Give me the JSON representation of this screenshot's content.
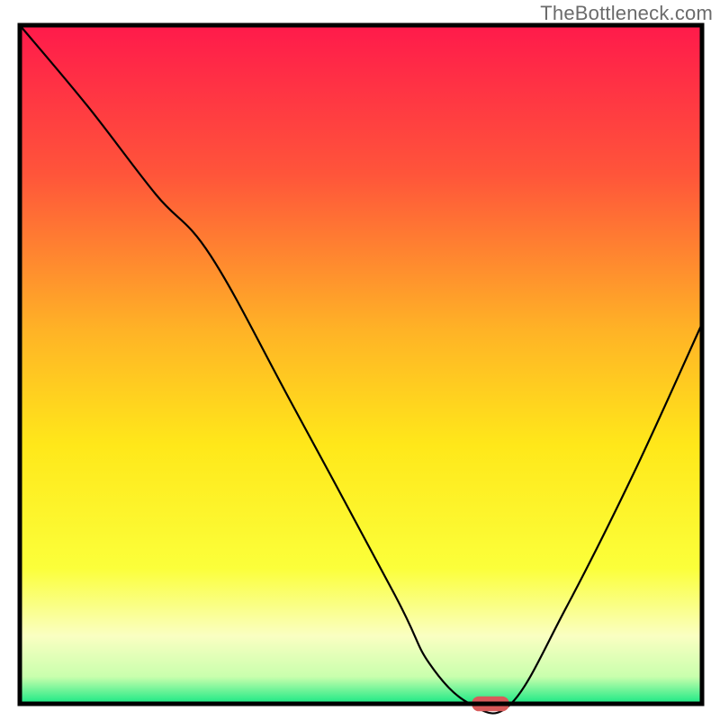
{
  "watermark": "TheBottleneck.com",
  "chart_data": {
    "type": "line",
    "title": "",
    "xlabel": "",
    "ylabel": "",
    "xlim": [
      0,
      100
    ],
    "ylim": [
      0,
      100
    ],
    "grid": false,
    "legend": false,
    "background_gradient": {
      "stops": [
        {
          "offset": 0.0,
          "color": "#ff1a4b"
        },
        {
          "offset": 0.22,
          "color": "#ff553a"
        },
        {
          "offset": 0.45,
          "color": "#ffb326"
        },
        {
          "offset": 0.62,
          "color": "#ffe81a"
        },
        {
          "offset": 0.8,
          "color": "#fbff3a"
        },
        {
          "offset": 0.9,
          "color": "#faffc2"
        },
        {
          "offset": 0.96,
          "color": "#c9ffad"
        },
        {
          "offset": 1.0,
          "color": "#17e884"
        }
      ]
    },
    "series": [
      {
        "name": "bottleneck-curve",
        "x": [
          0,
          10,
          20,
          28,
          40,
          55,
          60,
          66,
          72,
          80,
          90,
          100
        ],
        "y": [
          100,
          88,
          75,
          66,
          44,
          16,
          6,
          0,
          0,
          14,
          34,
          56
        ]
      }
    ],
    "marker": {
      "name": "optimal-point",
      "x": 69,
      "y": 0,
      "color": "#d85a5a",
      "width": 5.5,
      "height": 2.2
    }
  }
}
